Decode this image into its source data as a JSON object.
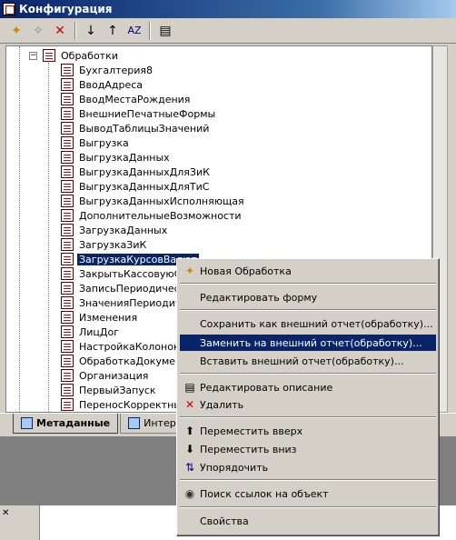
{
  "window": {
    "title": "Конфигурация"
  },
  "tree": {
    "root": "Обработки",
    "items": [
      "Бухгалтерия8",
      "ВводАдреса",
      "ВводМестаРождения",
      "ВнешниеПечатныеФормы",
      "ВыводТаблицыЗначений",
      "Выгрузка",
      "ВыгрузкаДанных",
      "ВыгрузкаДанныхДляЗиК",
      "ВыгрузкаДанныхДляТиС",
      "ВыгрузкаДанныхИсполняющая",
      "ДополнительныеВозможности",
      "ЗагрузкаДанных",
      "ЗагрузкаЗиК",
      "ЗагрузкаКурсовВалют",
      "ЗакрытьКассовуюСм",
      "ЗаписьПериодическ",
      "ЗначенияПериодичес",
      "Изменения",
      "ЛицДог",
      "НастройкаКолонок",
      "ОбработкаДокумент",
      "Организация",
      "ПервыйЗапуск",
      "ПереносКорректных"
    ],
    "selected_index": 13
  },
  "tabs": [
    {
      "label": "Метаданные"
    },
    {
      "label": "Интерфе"
    }
  ],
  "context_menu": {
    "items": [
      {
        "label": "Новая Обработка",
        "icon": "new-item-icon"
      },
      {
        "label": "Редактировать форму"
      },
      {
        "label": "Сохранить как внешний отчет(обработку)..."
      },
      {
        "label": "Заменить на внешний отчет(обработку)..."
      },
      {
        "label": "Вставить внешний отчет(обработку)..."
      },
      {
        "label": "Редактировать описание",
        "icon": "document-icon"
      },
      {
        "label": "Удалить",
        "icon": "delete-icon"
      },
      {
        "label": "Переместить вверх",
        "icon": "arrow-up-icon"
      },
      {
        "label": "Переместить вниз",
        "icon": "arrow-down-icon"
      },
      {
        "label": "Упорядочить",
        "icon": "sort-az-icon"
      },
      {
        "label": "Поиск ссылок на объект",
        "icon": "binoculars-icon"
      },
      {
        "label": "Свойства"
      }
    ],
    "highlighted_index": 3
  },
  "colors": {
    "highlight": "#0a246a",
    "face": "#d4d0c8"
  }
}
